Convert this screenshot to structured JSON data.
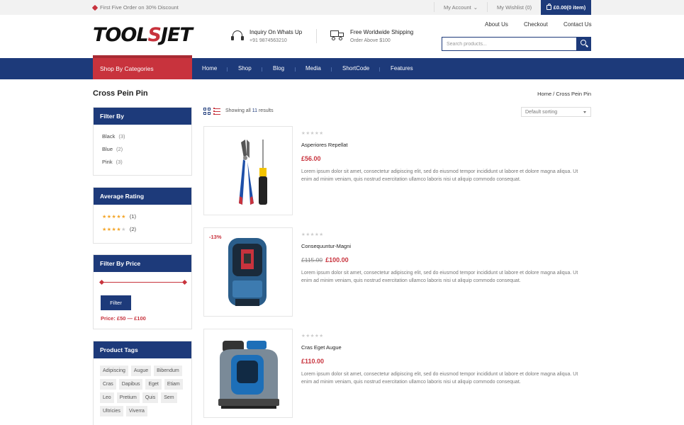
{
  "topbar": {
    "promo": "First Five Order on 30% Discount",
    "account": "My Account",
    "wishlist": "My Wishlist (0)",
    "cart": "£0.00(0 item)"
  },
  "brand": {
    "logo_part1": "TOOL",
    "logo_part2": "S",
    "logo_part3": "JET",
    "accent": "#c8333d",
    "primary": "#1d3a7a"
  },
  "header": {
    "inquiry_title": "Inquiry On Whats Up",
    "inquiry_phone": "+91 9874563210",
    "shipping_title": "Free Worldwide Shipping",
    "shipping_sub": "Order Above $100",
    "links": [
      "About Us",
      "Checkout",
      "Contact Us"
    ],
    "search_placeholder": "Search products..."
  },
  "nav": {
    "categories": "Shop By Categories",
    "items": [
      "Home",
      "Shop",
      "Blog",
      "Media",
      "ShortCode",
      "Features"
    ]
  },
  "page": {
    "title": "Cross Pein Pin",
    "breadcrumb": "Home / Cross Pein Pin"
  },
  "sidebar": {
    "filter_by": {
      "title": "Filter By",
      "items": [
        {
          "label": "Black",
          "count": "(3)"
        },
        {
          "label": "Blue",
          "count": "(2)"
        },
        {
          "label": "Pink",
          "count": "(3)"
        }
      ]
    },
    "rating": {
      "title": "Average Rating",
      "items": [
        {
          "stars": 5,
          "count": "(1)"
        },
        {
          "stars": 4,
          "count": "(2)"
        }
      ]
    },
    "price": {
      "title": "Filter By Price",
      "button": "Filter",
      "label": "Price: £50 — £100"
    },
    "tags": {
      "title": "Product Tags",
      "items": [
        "Adipiscing",
        "Augue",
        "Bibendum",
        "Cras",
        "Dapibus",
        "Eget",
        "Etiam",
        "Leo",
        "Pretium",
        "Quis",
        "Sem",
        "Ultricies",
        "Viverra"
      ]
    }
  },
  "toolbar": {
    "showing_pre": "Showing all ",
    "showing_count": "11",
    "showing_post": " results",
    "sorting": "Default sorting"
  },
  "products": [
    {
      "name": "Asperiores Repellat",
      "price": "£56.00",
      "old_price": "",
      "sale": "",
      "rating": "★★★★★",
      "desc": "Lorem ipsum dolor sit amet, consectetur adipiscing elit, sed do eiusmod tempor incididunt ut labore et dolore magna aliqua. Ut enim ad minim veniam, quis nostrud exercitation ullamco laboris nisi ut aliquip commodo consequat."
    },
    {
      "name": "Consequuntur-Magni",
      "price": "£100.00",
      "old_price": "£115.00",
      "sale": "-13%",
      "rating": "★★★★★",
      "desc": "Lorem ipsum dolor sit amet, consectetur adipiscing elit, sed do eiusmod tempor incididunt ut labore et dolore magna aliqua. Ut enim ad minim veniam, quis nostrud exercitation ullamco laboris nisi ut aliquip commodo consequat."
    },
    {
      "name": "Cras Eget Augue",
      "price": "£110.00",
      "old_price": "",
      "sale": "",
      "rating": "★★★★★",
      "desc": "Lorem ipsum dolor sit amet, consectetur adipiscing elit, sed do eiusmod tempor incididunt ut labore et dolore magna aliqua. Ut enim ad minim veniam, quis nostrud exercitation ullamco laboris nisi ut aliquip commodo consequat."
    }
  ]
}
